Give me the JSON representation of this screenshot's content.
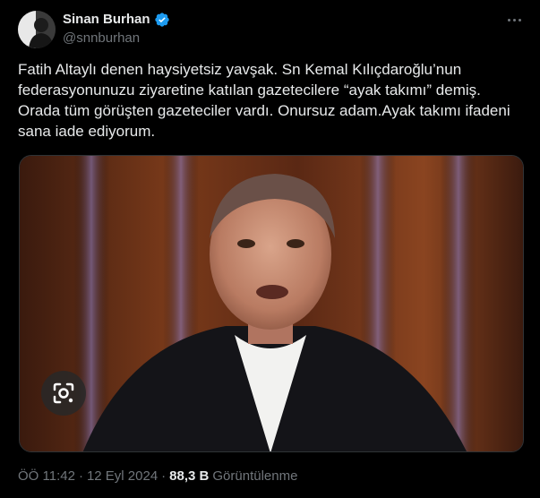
{
  "author": {
    "display_name": "Sinan Burhan",
    "handle": "@snnburhan",
    "verified": true
  },
  "tweet": {
    "text": "Fatih Altaylı denen haysiyetsiz yavşak. Sn Kemal Kılıçdaroğlu’nun\nfederasyonunuzu ziyaretine katılan gazetecilere “ayak takımı” demiş.\nOrada tüm görüşten gazeteciler vardı. Onursuz adam.Ayak takımı ifadeni\nsana iade ediyorum.",
    "time": "ÖÖ 11:42",
    "separator": "·",
    "date": "12 Eyl 2024",
    "views_count": "88,3 B",
    "views_label": "Görüntülenme"
  },
  "colors": {
    "background": "#000000",
    "text_primary": "#e7e9ea",
    "text_secondary": "#71767b",
    "verified": "#1d9bf0",
    "border": "#2f3336"
  },
  "icons": {
    "more": "more-options-icon",
    "verified": "verified-badge-icon",
    "lens": "google-lens-icon"
  }
}
